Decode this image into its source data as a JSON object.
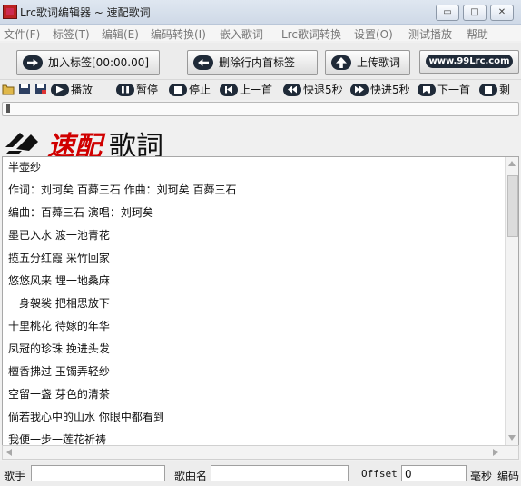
{
  "window": {
    "title": "Lrc歌词编辑器 ~ 速配歌词",
    "controls": [
      "▭",
      "□",
      "✕"
    ]
  },
  "menu": [
    "文件(F)",
    "标签(T)",
    "编辑(E)",
    "编码转换(I)",
    "嵌入歌词",
    "Lrc歌词转换",
    "设置(O)",
    "测试播放",
    "帮助"
  ],
  "toolbar": {
    "add_tag": "加入标签[00:00.00]",
    "delete_tag": "删除行内首标签",
    "upload": "上传歌词",
    "site": "www.99Lrc.com"
  },
  "playbar": {
    "play": "播放",
    "pause": "暂停",
    "stop": "停止",
    "prev": "上一首",
    "rewind": "快退5秒",
    "forward": "快进5秒",
    "next": "下一首",
    "more": "剩"
  },
  "logo": {
    "text_red": "速配",
    "text_black": "歌詞"
  },
  "lyrics": [
    "半壶纱",
    "作词：刘珂矣 百蕣三石 作曲：刘珂矣 百蕣三石",
    "编曲：百蕣三石 演唱：刘珂矣",
    "墨已入水 渡一池青花",
    "揽五分红霞 采竹回家",
    "悠悠风来 埋一地桑麻",
    "一身袈裟 把相思放下",
    "十里桃花 待嫁的年华",
    "凤冠的珍珠 挽进头发",
    "檀香拂过 玉镯弄轻纱",
    "空留一盏 芽色的清茶",
    "倘若我心中的山水 你眼中都看到",
    "我便一步一莲花祈祷"
  ],
  "status": {
    "singer_label": "歌手",
    "singer_value": "",
    "song_label": "歌曲名",
    "song_value": "",
    "offset_label": "Offset",
    "offset_value": "0",
    "ms_label": "毫秒",
    "encoding_label": "编码"
  },
  "colors": {
    "accent_red": "#d00000",
    "button_dark": "#1f2a38"
  }
}
